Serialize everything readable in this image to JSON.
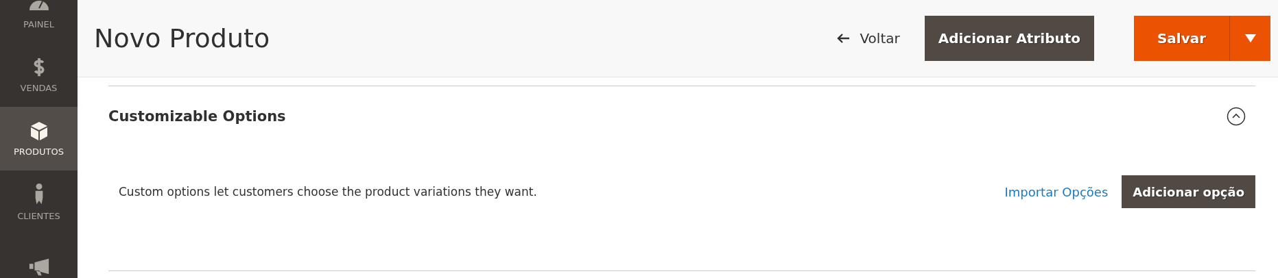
{
  "sidebar": {
    "items": [
      {
        "label": "PAINEL",
        "selected": false
      },
      {
        "label": "VENDAS",
        "selected": false
      },
      {
        "label": "PRODUTOS",
        "selected": true
      },
      {
        "label": "CLIENTES",
        "selected": false
      },
      {
        "selected": false
      }
    ]
  },
  "header": {
    "title": "Novo Produto",
    "back": "Voltar",
    "add_attribute": "Adicionar Atributo",
    "save": "Salvar"
  },
  "section": {
    "title": "Customizable Options",
    "expanded": true,
    "description": "Custom options let customers choose the product variations they want.",
    "import_link": "Importar Opções",
    "add_button": "Adicionar opção"
  }
}
